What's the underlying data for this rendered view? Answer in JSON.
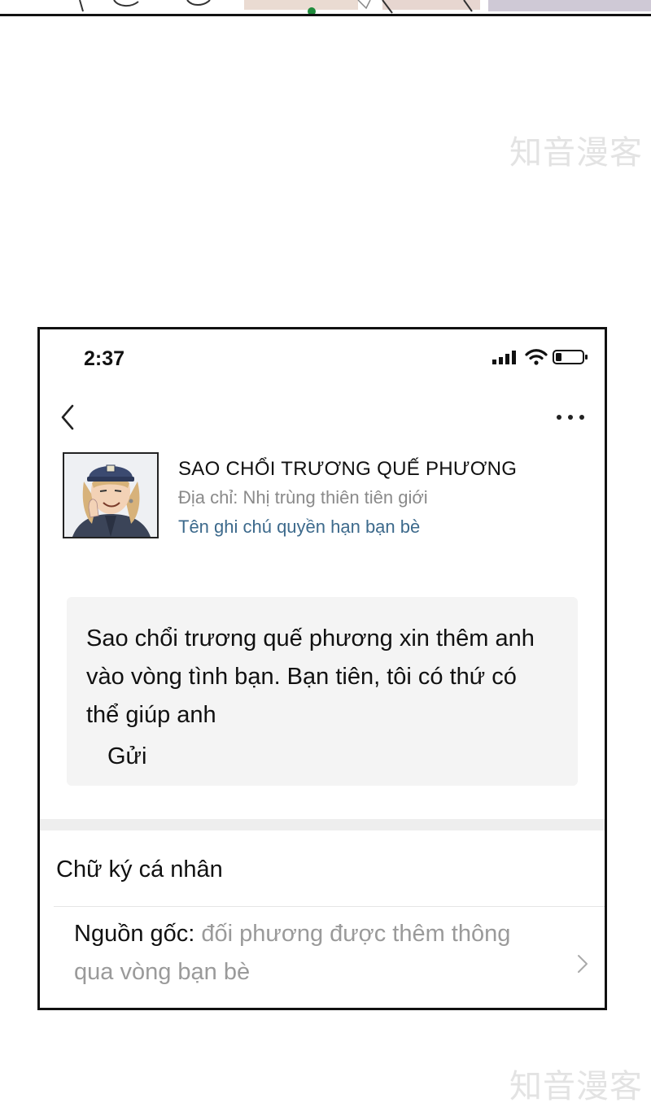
{
  "watermark": "知音漫客",
  "status_bar": {
    "time": "2:37",
    "icons": [
      "signal-icon",
      "wifi-icon",
      "battery-icon"
    ]
  },
  "nav": {
    "back_icon": "chevron-left-icon",
    "more_icon": "more-dots-icon"
  },
  "profile": {
    "name": "SAO CHỔI TRƯƠNG QUẾ PHƯƠNG",
    "address": "Địa chỉ: Nhị trùng thiên tiên giới",
    "permission_link": "Tên ghi chú quyền hạn bạn bè"
  },
  "message": {
    "text": "Sao chổi trương quế phương xin thêm anh vào vòng tình bạn. Bạn tiên, tôi có thứ có thể giúp anh",
    "send_label": "Gửi"
  },
  "signature": {
    "label": "Chữ ký cá nhân"
  },
  "source": {
    "label": "Nguồn gốc:",
    "value": " đối phương được thêm thông qua vòng bạn bè"
  },
  "colors": {
    "link": "#3d6a8c",
    "secondary_text": "#8a8a8a",
    "message_bg": "#f4f4f4",
    "divider": "#eeeeee"
  }
}
